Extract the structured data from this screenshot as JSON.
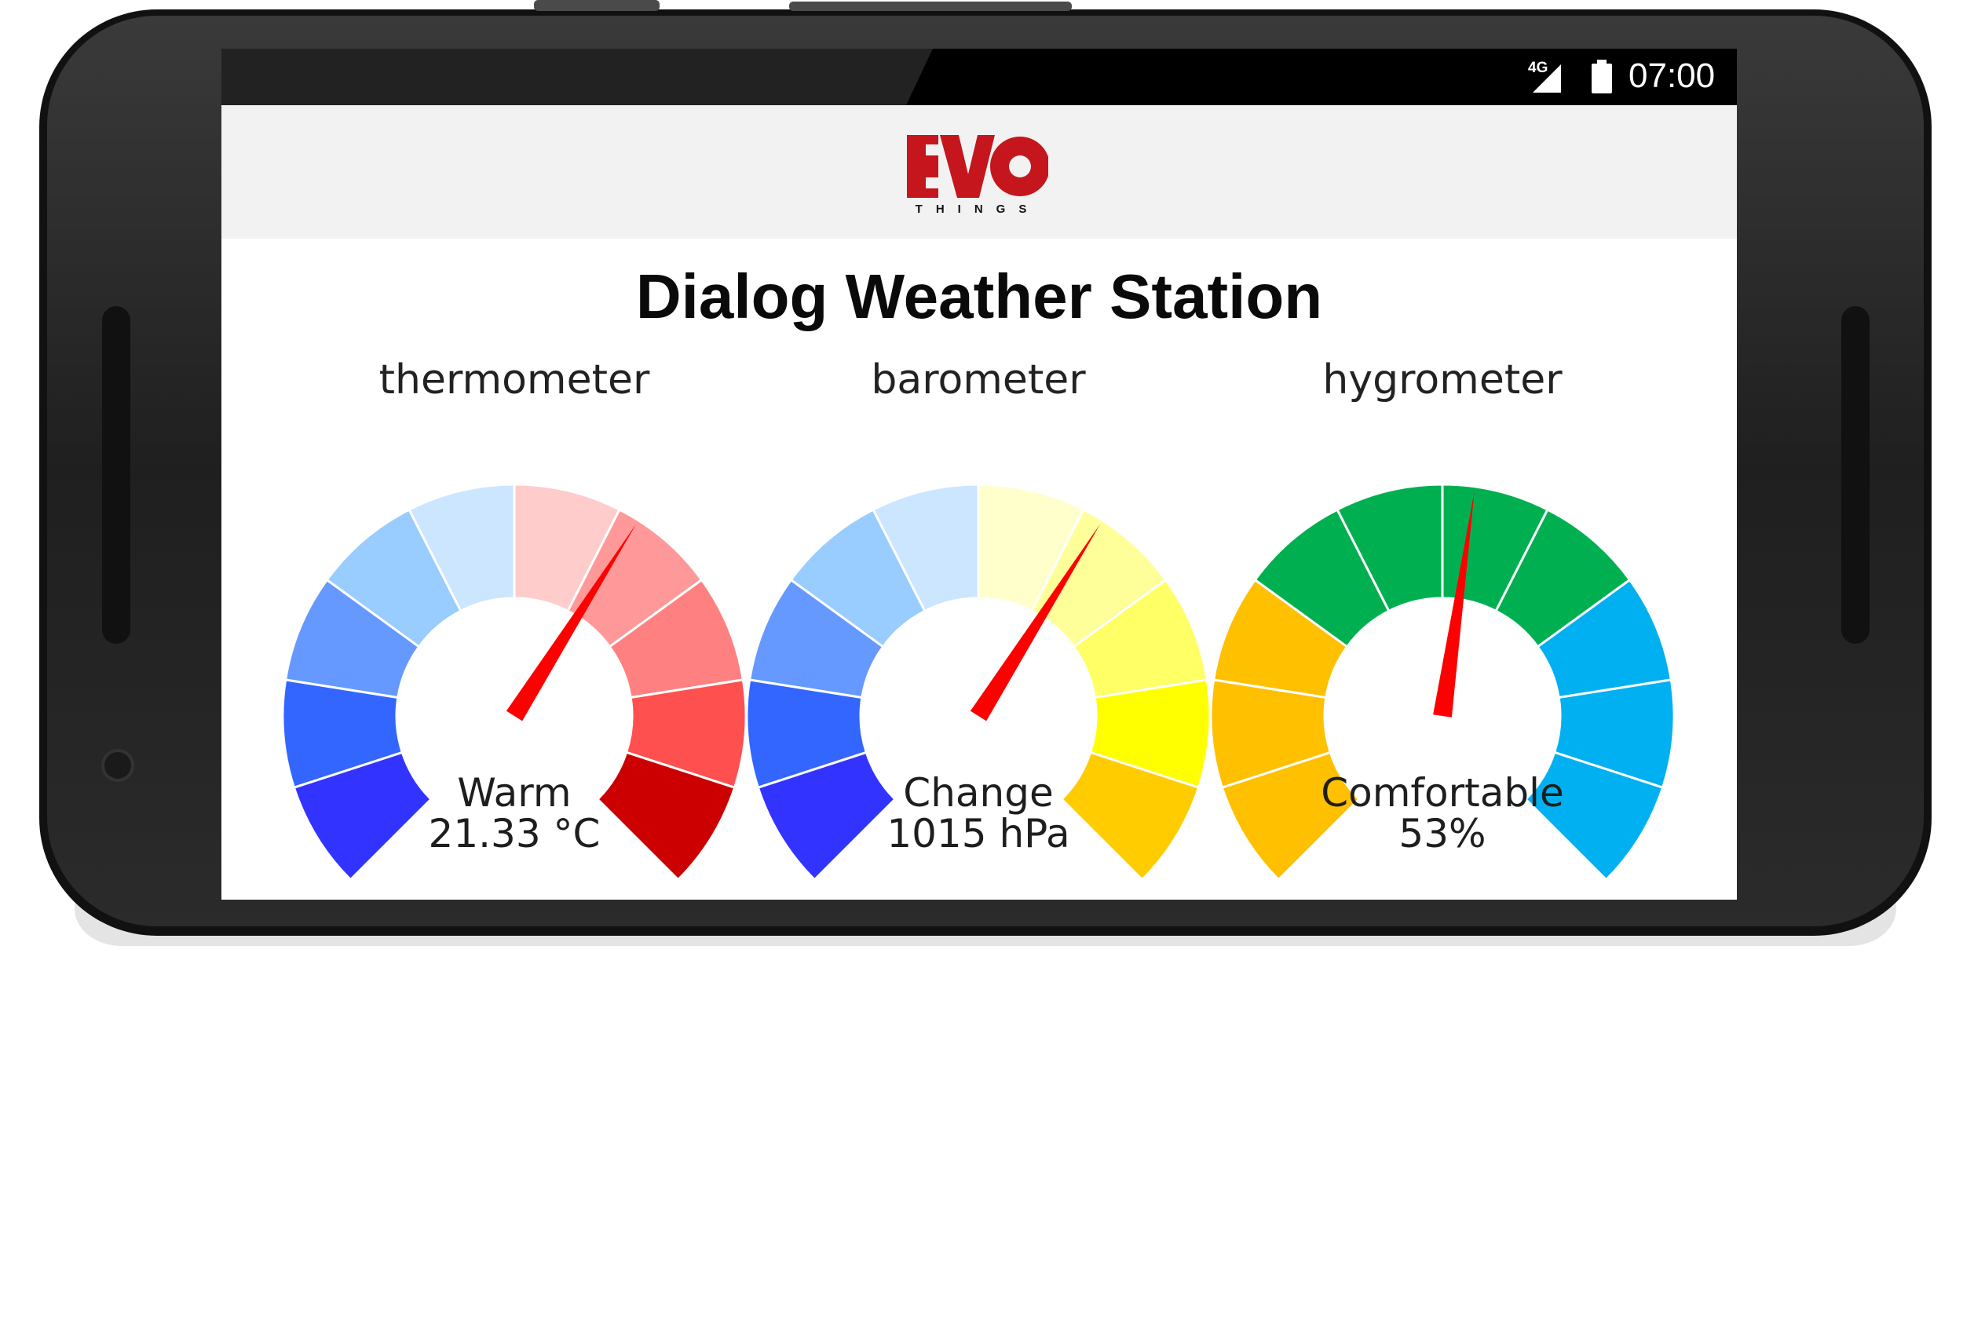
{
  "status_bar": {
    "network": "4G",
    "time": "07:00"
  },
  "header": {
    "logo_text": "EVO",
    "logo_subtext": "THINGS",
    "brand_color": "#c4161c"
  },
  "title": "Dialog Weather Station",
  "gauges": [
    {
      "label": "thermometer",
      "status": "Warm",
      "value": "21.33 °C",
      "needle_fraction": 0.62,
      "segment_colors": [
        "#3333ff",
        "#3366ff",
        "#6699ff",
        "#99ccff",
        "#cce6ff",
        "#ffcccc",
        "#ff9999",
        "#ff8080",
        "#ff5050",
        "#cc0000"
      ]
    },
    {
      "label": "barometer",
      "status": "Change",
      "value": "1015 hPa",
      "needle_fraction": 0.62,
      "segment_colors": [
        "#3333ff",
        "#3366ff",
        "#6699ff",
        "#99ccff",
        "#cce6ff",
        "#ffffcc",
        "#ffff99",
        "#ffff66",
        "#ffff00",
        "#ffcc00"
      ]
    },
    {
      "label": "hygrometer",
      "status": "Comfortable",
      "value": "53%",
      "needle_fraction": 0.53,
      "segment_colors": [
        "#ffc000",
        "#ffc000",
        "#ffc000",
        "#00b050",
        "#00b050",
        "#00b050",
        "#00b050",
        "#00b0f0",
        "#00b0f0",
        "#00b0f0"
      ]
    }
  ],
  "needle_color": "#ff0000"
}
